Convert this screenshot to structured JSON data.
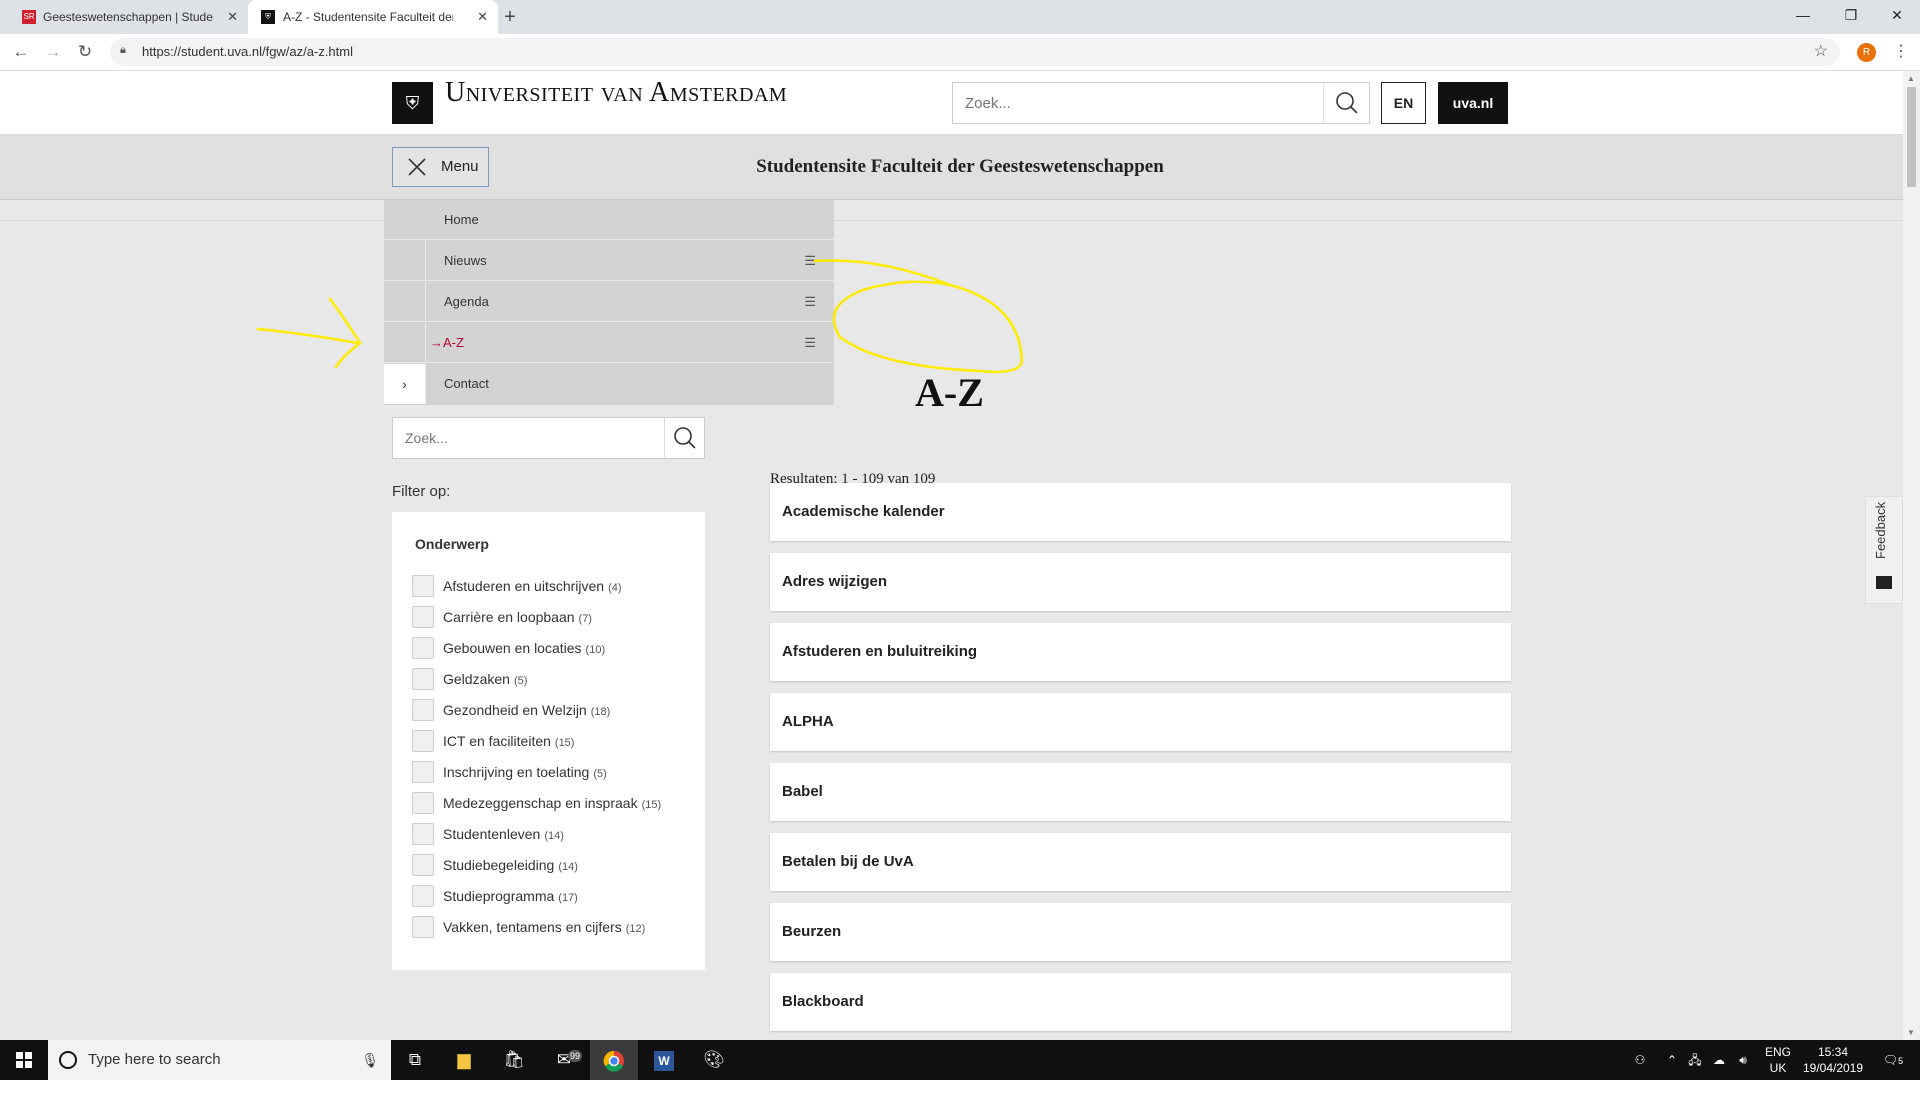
{
  "browser": {
    "tabs": [
      {
        "label": "Geesteswetenschappen | Student",
        "icon": "sr-favicon"
      },
      {
        "label": "A-Z - Studentensite Faculteit der",
        "icon": "uva-favicon"
      }
    ],
    "url": "https://student.uva.nl/fgw/az/a-z.html",
    "profile_initial": "R",
    "win_controls": [
      "—",
      "❐",
      "✕"
    ]
  },
  "header": {
    "logo_text": "Universiteit van Amsterdam",
    "search_placeholder": "Zoek...",
    "lang_button": "EN",
    "uva_button": "uva.nl"
  },
  "subheader": {
    "menu_label": "Menu",
    "site_title": "Studentensite Faculteit der Geesteswetenschappen"
  },
  "menu": {
    "items": [
      {
        "label": "Home"
      },
      {
        "label": "Nieuws"
      },
      {
        "label": "Agenda"
      },
      {
        "label": "→A-Z"
      },
      {
        "label": "Contact"
      }
    ]
  },
  "sidebar": {
    "search_placeholder": "Zoek...",
    "filter_label": "Filter op:",
    "filter_title": "Onderwerp",
    "filters": [
      {
        "label": "Afstuderen en uitschrijven",
        "count": "(4)"
      },
      {
        "label": "Carrière en loopbaan",
        "count": "(7)"
      },
      {
        "label": "Gebouwen en locaties",
        "count": "(10)"
      },
      {
        "label": "Geldzaken",
        "count": "(5)"
      },
      {
        "label": "Gezondheid en Welzijn",
        "count": "(18)"
      },
      {
        "label": "ICT en faciliteiten",
        "count": "(15)"
      },
      {
        "label": "Inschrijving en toelating",
        "count": "(5)"
      },
      {
        "label": "Medezeggenschap en inspraak",
        "count": "(15)"
      },
      {
        "label": "Studentenleven",
        "count": "(14)"
      },
      {
        "label": "Studiebegeleiding",
        "count": "(14)"
      },
      {
        "label": "Studieprogramma",
        "count": "(17)"
      },
      {
        "label": "Vakken, tentamens en cijfers",
        "count": "(12)"
      }
    ]
  },
  "main": {
    "title": "A-Z",
    "results": "Resultaten: 1 - 109 van 109",
    "items": [
      "Academische kalender",
      "Adres wijzigen",
      "Afstuderen en buluitreiking",
      "ALPHA",
      "Babel",
      "Betalen bij de UvA",
      "Beurzen",
      "Blackboard"
    ]
  },
  "feedback": {
    "label": "Feedback"
  },
  "taskbar": {
    "search_placeholder": "Type here to search",
    "mail_badge": "99",
    "lang_top": "ENG",
    "lang_bottom": "UK",
    "time": "15:34",
    "date": "19/04/2019",
    "notif_count": "5"
  },
  "colors": {
    "accent": "#bc0031",
    "annotation": "#ffeb00"
  }
}
